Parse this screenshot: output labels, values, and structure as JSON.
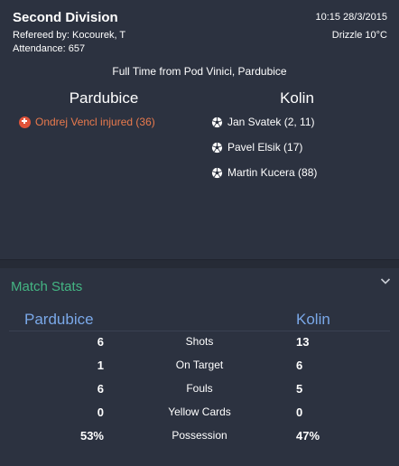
{
  "match": {
    "competition": "Second Division",
    "referee": "Refereed by: Kocourek, T",
    "attendance": "Attendance: 657",
    "datetime": "10:15 28/3/2015",
    "weather": "Drizzle 10°C",
    "result_line": "Full Time from Pod Vinici, Pardubice",
    "home_team": "Pardubice",
    "away_team": "Kolin",
    "home_events": [
      {
        "text": "Ondrej Vencl injured (36)",
        "icon": "injury-icon"
      }
    ],
    "away_events": [
      {
        "text": "Jan Svatek (2, 11)",
        "icon": "football-icon"
      },
      {
        "text": "Pavel Elsik (17)",
        "icon": "football-icon"
      },
      {
        "text": "Martin Kucera (88)",
        "icon": "football-icon"
      }
    ]
  },
  "stats": {
    "header": "Match Stats",
    "home_team": "Pardubice",
    "away_team": "Kolin",
    "rows": [
      {
        "home": "6",
        "label": "Shots",
        "away": "13"
      },
      {
        "home": "1",
        "label": "On Target",
        "away": "6"
      },
      {
        "home": "6",
        "label": "Fouls",
        "away": "5"
      },
      {
        "home": "0",
        "label": "Yellow Cards",
        "away": "0"
      },
      {
        "home": "53%",
        "label": "Possession",
        "away": "47%"
      }
    ]
  },
  "colors": {
    "background": "#262b36",
    "panel": "#2c3240",
    "injury": "#e97a4d",
    "section_header": "#44b583",
    "team_stats": "#7aa8e8"
  }
}
